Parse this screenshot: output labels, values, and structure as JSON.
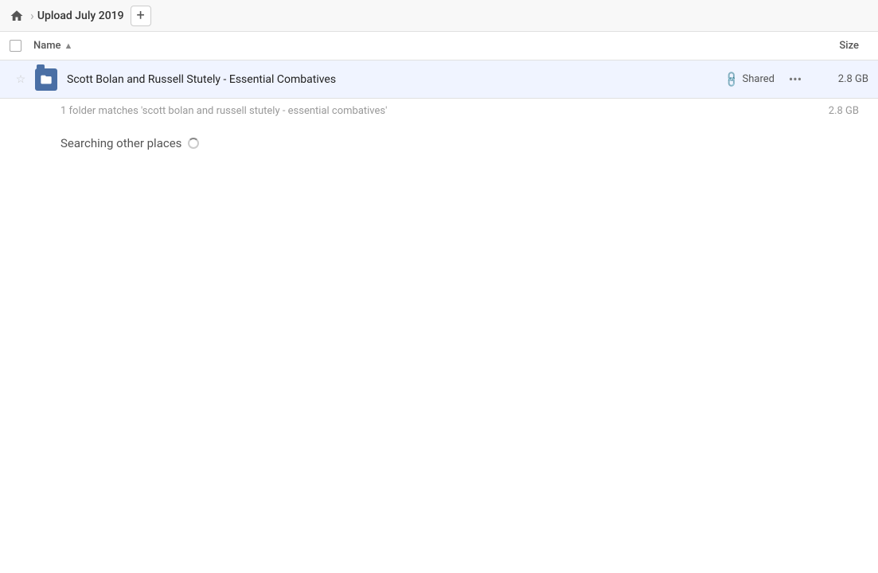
{
  "header": {
    "home_label": "Home",
    "breadcrumb_title": "Upload July 2019",
    "add_button_label": "+"
  },
  "columns": {
    "name_label": "Name",
    "sort_indicator": "▲",
    "size_label": "Size"
  },
  "file_row": {
    "name": "Scott Bolan and Russell Stutely - Essential Combatives",
    "shared_label": "Shared",
    "size": "2.8 GB",
    "more_label": "•••"
  },
  "match_info": {
    "text": "1 folder matches 'scott bolan and russell stutely - essential combatives'",
    "size": "2.8 GB"
  },
  "searching": {
    "label": "Searching other places"
  }
}
